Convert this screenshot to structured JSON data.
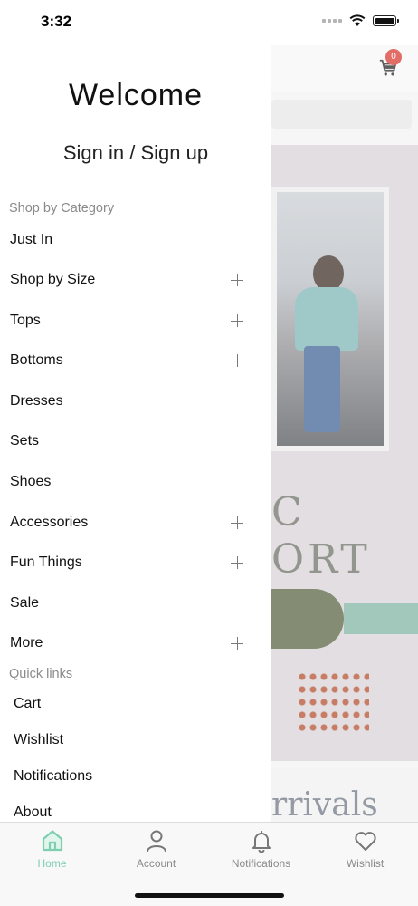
{
  "status_bar": {
    "time": "3:32"
  },
  "background": {
    "cart_count": "0",
    "banner_text": "C\nORT",
    "section_heading": "rrivals"
  },
  "drawer": {
    "welcome": "Welcome",
    "signin": "Sign in / Sign up",
    "shop_by_category_title": "Shop by Category",
    "categories": [
      {
        "label": "Just In"
      },
      {
        "label": "Shop by Size"
      },
      {
        "label": "Tops"
      },
      {
        "label": "Bottoms"
      },
      {
        "label": "Dresses"
      },
      {
        "label": "Sets"
      },
      {
        "label": "Shoes"
      },
      {
        "label": "Accessories"
      },
      {
        "label": "Fun Things"
      },
      {
        "label": "Sale"
      },
      {
        "label": "More"
      }
    ],
    "quick_links_title": "Quick links",
    "quick_links": [
      {
        "label": "Cart"
      },
      {
        "label": "Wishlist"
      },
      {
        "label": "Notifications"
      },
      {
        "label": "About"
      }
    ]
  },
  "tab_bar": {
    "tabs": [
      {
        "label": "Home",
        "icon": "home-icon",
        "active": true
      },
      {
        "label": "Account",
        "icon": "person-icon",
        "active": false
      },
      {
        "label": "Notifications",
        "icon": "bell-icon",
        "active": false
      },
      {
        "label": "Wishlist",
        "icon": "heart-icon",
        "active": false
      }
    ]
  },
  "colors": {
    "accent": "#7dcfb0",
    "badge": "#d7342c",
    "muted_text": "#8a8a8a"
  }
}
